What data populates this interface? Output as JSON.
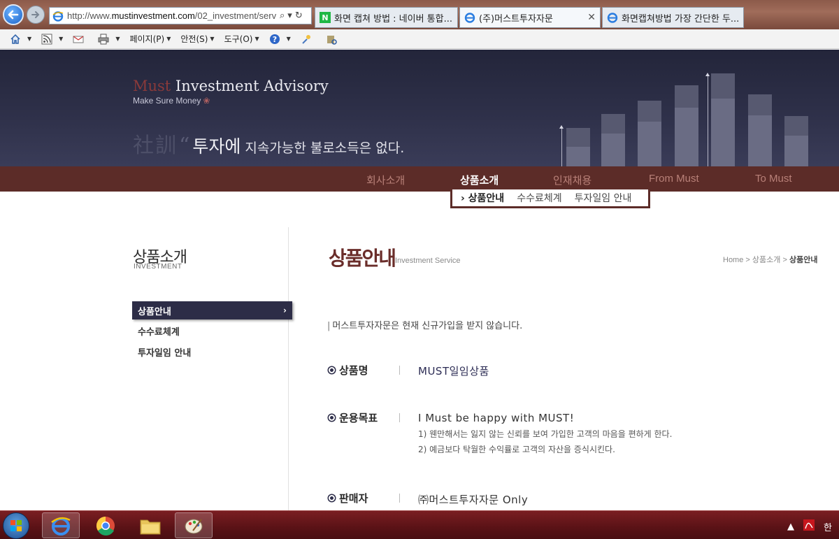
{
  "browser": {
    "url_prefix": "http://www.",
    "url_host": "mustinvestment.com",
    "url_path": "/02_investment/serv",
    "search_glyph": "⌕",
    "caret_glyph": "▾",
    "refresh_glyph": "↻",
    "tabs": [
      {
        "label": "화면 캡쳐 방법 : 네이버 통합...",
        "favicon": "naver-icon",
        "active": false
      },
      {
        "label": "(주)머스트투자자문",
        "favicon": "ie-icon",
        "active": true,
        "close": "✕"
      },
      {
        "label": "화면캡쳐방법 가장 간단한 두...",
        "favicon": "ie-icon",
        "active": false
      }
    ],
    "commands": {
      "page": "페이지(P)",
      "safety": "안전(S)",
      "tools": "도구(O)"
    }
  },
  "header": {
    "logo_must": "Must",
    "logo_rest": " Investment Advisory",
    "tagline": "Make Sure Money",
    "tagline_mark": "❀",
    "slogan_hanja": "社訓",
    "slogan_quote": "“",
    "slogan_big": "투자에",
    "slogan_small": " 지속가능한 불로소득은 없다."
  },
  "nav": {
    "items": [
      "회사소개",
      "상품소개",
      "인재채용",
      "From Must",
      "To Must"
    ],
    "active_index": 1,
    "sub_items": [
      "상품안내",
      "수수료체계",
      "투자일임 안내"
    ]
  },
  "sidebar": {
    "title": "상품소개",
    "subtitle": "INVESTMENT",
    "items": [
      "상품안내",
      "수수료체계",
      "투자일임 안내"
    ],
    "chev": "›"
  },
  "content": {
    "title": "상품안내",
    "subtitle": "Investment Service",
    "breadcrumb": {
      "home": "Home",
      "parent": "상품소개",
      "current": "상품안내",
      "sep": ">"
    },
    "notice": "머스트투자자문은 현재 신규가입을 받지 않습니다.",
    "rows": {
      "product": {
        "label": "상품명",
        "value": "MUST일임상품"
      },
      "goal": {
        "label": "운용목표",
        "value": "I Must be happy with MUST!",
        "line1": "1) 웬만해서는 잃지 않는 신뢰를 보여 가입한 고객의 마음을 편하게 한다.",
        "line2": "2) 예금보다 탁월한 수익률로 고객의 자산을 증식시킨다."
      },
      "seller": {
        "label": "판매자",
        "value": "㈜머스트투자자문 Only"
      }
    }
  },
  "taskbar": {
    "tray_arrow": "▲",
    "tray_lang": "한"
  },
  "colors": {
    "header_bg": "#2e3049",
    "nav_bg": "#5c2c28",
    "title_red": "#6a2d2a",
    "sidebar_active": "#2d2d47"
  }
}
